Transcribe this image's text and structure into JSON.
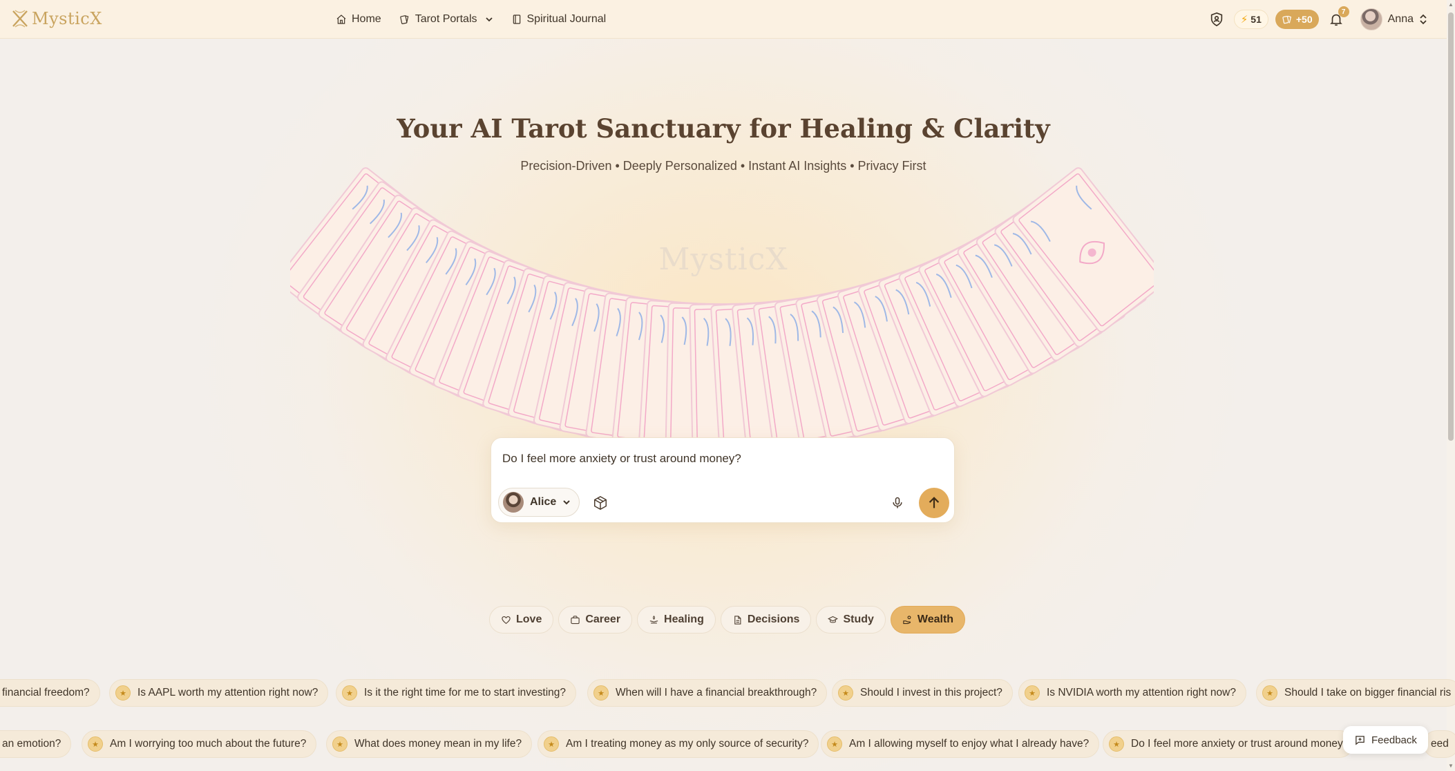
{
  "brand": {
    "name": "MysticX"
  },
  "nav": {
    "home": "Home",
    "tarot_portals": "Tarot Portals",
    "journal": "Spiritual Journal"
  },
  "toolbar": {
    "energy": "51",
    "bonus": "+50",
    "notifications": "7",
    "user_name": "Anna"
  },
  "hero": {
    "title": "Your AI Tarot Sanctuary for Healing & Clarity",
    "subtitle": "Precision-Driven • Deeply Personalized • Instant AI Insights • Privacy First",
    "watermark": "MysticX"
  },
  "ask": {
    "question": "Do I feel more anxiety or trust around money?",
    "reader": "Alice"
  },
  "categories": [
    {
      "label": "Love",
      "icon": "heart-icon",
      "active": false
    },
    {
      "label": "Career",
      "icon": "briefcase-icon",
      "active": false
    },
    {
      "label": "Healing",
      "icon": "healing-hands-icon",
      "active": false
    },
    {
      "label": "Decisions",
      "icon": "document-icon",
      "active": false
    },
    {
      "label": "Study",
      "icon": "graduation-cap-icon",
      "active": false
    },
    {
      "label": "Wealth",
      "icon": "wealth-hand-icon",
      "active": true
    }
  ],
  "questions_row1": [
    "financial freedom?",
    "Is AAPL worth my attention right now?",
    "Is it the right time for me to start investing?",
    "When will I have a financial breakthrough?",
    "Should I invest in this project?",
    "Is NVIDIA worth my attention right now?",
    "Should I take on bigger financial ris"
  ],
  "questions_row2": [
    "an emotion?",
    "Am I worrying too much about the future?",
    "What does money mean in my life?",
    "Am I treating money as my only source of security?",
    "Am I allowing myself to enjoy what I already have?",
    "Do I feel more anxiety or trust around money",
    "eed"
  ],
  "feedback": {
    "label": "Feedback"
  },
  "colors": {
    "accent": "#e3ac5b",
    "brand_gold": "#c9a45f",
    "title_brown": "#5a4330",
    "card_pink": "#f3a9c8",
    "card_blue": "#9fb8e6"
  }
}
